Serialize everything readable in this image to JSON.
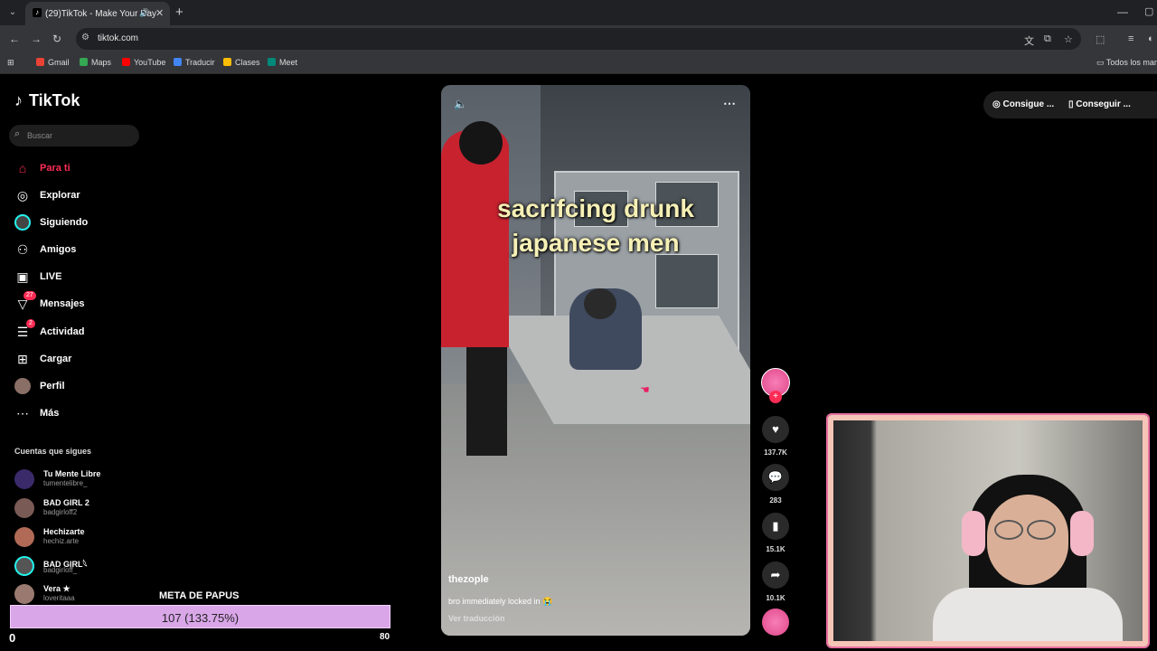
{
  "browser": {
    "tab_title": "(29)TikTok - Make Your Day",
    "tab_sound_icon": "speaker-icon",
    "url": "tiktok.com",
    "bookmarks": [
      {
        "label": "Gmail",
        "color": "#ea4335"
      },
      {
        "label": "Maps",
        "color": "#34a853"
      },
      {
        "label": "YouTube",
        "color": "#ff0000"
      },
      {
        "label": "Traducir",
        "color": "#4285f4"
      },
      {
        "label": "Clases",
        "color": "#fbbc04"
      },
      {
        "label": "Meet",
        "color": "#00897b"
      }
    ],
    "all_bookmarks_label": "Todos los mar"
  },
  "tiktok": {
    "logo": "TikTok",
    "search_placeholder": "Buscar",
    "nav": [
      {
        "label": "Para ti",
        "icon": "home-icon",
        "active": true
      },
      {
        "label": "Explorar",
        "icon": "compass-icon"
      },
      {
        "label": "Siguiendo",
        "icon": "following-avatar-icon"
      },
      {
        "label": "Amigos",
        "icon": "friends-icon"
      },
      {
        "label": "LIVE",
        "icon": "live-icon"
      },
      {
        "label": "Mensajes",
        "icon": "inbox-icon",
        "badge": "27"
      },
      {
        "label": "Actividad",
        "icon": "activity-icon",
        "badge": "2"
      },
      {
        "label": "Cargar",
        "icon": "upload-icon"
      },
      {
        "label": "Perfil",
        "icon": "profile-avatar-icon"
      },
      {
        "label": "Más",
        "icon": "more-icon"
      }
    ],
    "following_header": "Cuentas que sigues",
    "following": [
      {
        "name": "Tu Mente Libre",
        "handle": "tumentelibre_"
      },
      {
        "name": "BAD GIRL 2",
        "handle": "badgirloff2"
      },
      {
        "name": "Hechizarte",
        "handle": "hechiz.arte"
      },
      {
        "name": "BAD GIRL𓆩",
        "handle": "badgirloff_"
      },
      {
        "name": "Vera ★",
        "handle": "loveritaaa"
      }
    ],
    "top_pills": [
      "Consigue ...",
      "Conseguir ..."
    ]
  },
  "video": {
    "caption_line1": "sacrifcing drunk",
    "caption_line2": "japanese men",
    "author": "thezople",
    "description": "bro immediately locked in 😭",
    "translate_label": "Ver traducción",
    "likes": "137.7K",
    "comments": "283",
    "saves": "15.1K",
    "shares": "10.1K"
  },
  "goal": {
    "title": "META DE PAPUS",
    "value": "107 (133.75%)",
    "min": "0",
    "max": "80",
    "progress_percent": 133.75,
    "color": "#d9a6e8"
  }
}
